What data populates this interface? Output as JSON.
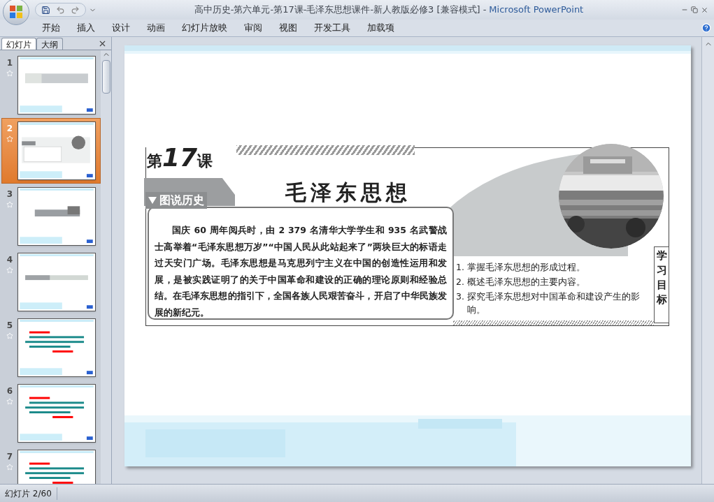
{
  "window": {
    "title": "高中历史-第六单元-第17课-毛泽东思想课件-新人教版必修3 [兼容模式]",
    "separator": "-",
    "app": "Microsoft PowerPoint"
  },
  "ribbon_tabs": [
    {
      "label": "开始",
      "selected": false
    },
    {
      "label": "插入",
      "selected": false
    },
    {
      "label": "设计",
      "selected": false
    },
    {
      "label": "动画",
      "selected": false
    },
    {
      "label": "幻灯片放映",
      "selected": false
    },
    {
      "label": "审阅",
      "selected": false
    },
    {
      "label": "视图",
      "selected": false
    },
    {
      "label": "开发工具",
      "selected": false
    },
    {
      "label": "加载项",
      "selected": false
    }
  ],
  "pane_tabs": [
    {
      "label": "幻灯片",
      "selected": true
    },
    {
      "label": "大纲",
      "selected": false
    }
  ],
  "thumbnails": [
    {
      "number": "1",
      "selected": false,
      "kind": "title"
    },
    {
      "number": "2",
      "selected": true,
      "kind": "lesson"
    },
    {
      "number": "3",
      "selected": false,
      "kind": "banner"
    },
    {
      "number": "4",
      "selected": false,
      "kind": "section"
    },
    {
      "number": "5",
      "selected": false,
      "kind": "text"
    },
    {
      "number": "6",
      "selected": false,
      "kind": "text"
    },
    {
      "number": "7",
      "selected": false,
      "kind": "text"
    }
  ],
  "slide": {
    "lesson": {
      "prefix": "第",
      "number": "17",
      "suffix": "课"
    },
    "title": "毛泽东思想",
    "section": "图说历史",
    "paragraph": "国庆 60 周年阅兵时，由 2 379 名清华大学学生和 935 名武警战士高举着“毛泽东思想万岁”“中国人民从此站起来了”两块巨大的标语走过天安门广场。毛泽东思想是马克思列宁主义在中国的创造性运用和发展，是被实践证明了的关于中国革命和建设的正确的理论原则和经验总结。在毛泽东思想的指引下，全国各族人民艰苦奋斗，开启了中华民族发展的新纪元。",
    "objectives": [
      "1. 掌握毛泽东思想的形成过程。",
      "2. 概述毛泽东思想的主要内容。",
      "3. 探究毛泽东思想对中国革命和建设产生的影响。"
    ],
    "side_label": "学习目标"
  },
  "status_bar": {
    "slide_counter": "幻灯片 2/60"
  }
}
